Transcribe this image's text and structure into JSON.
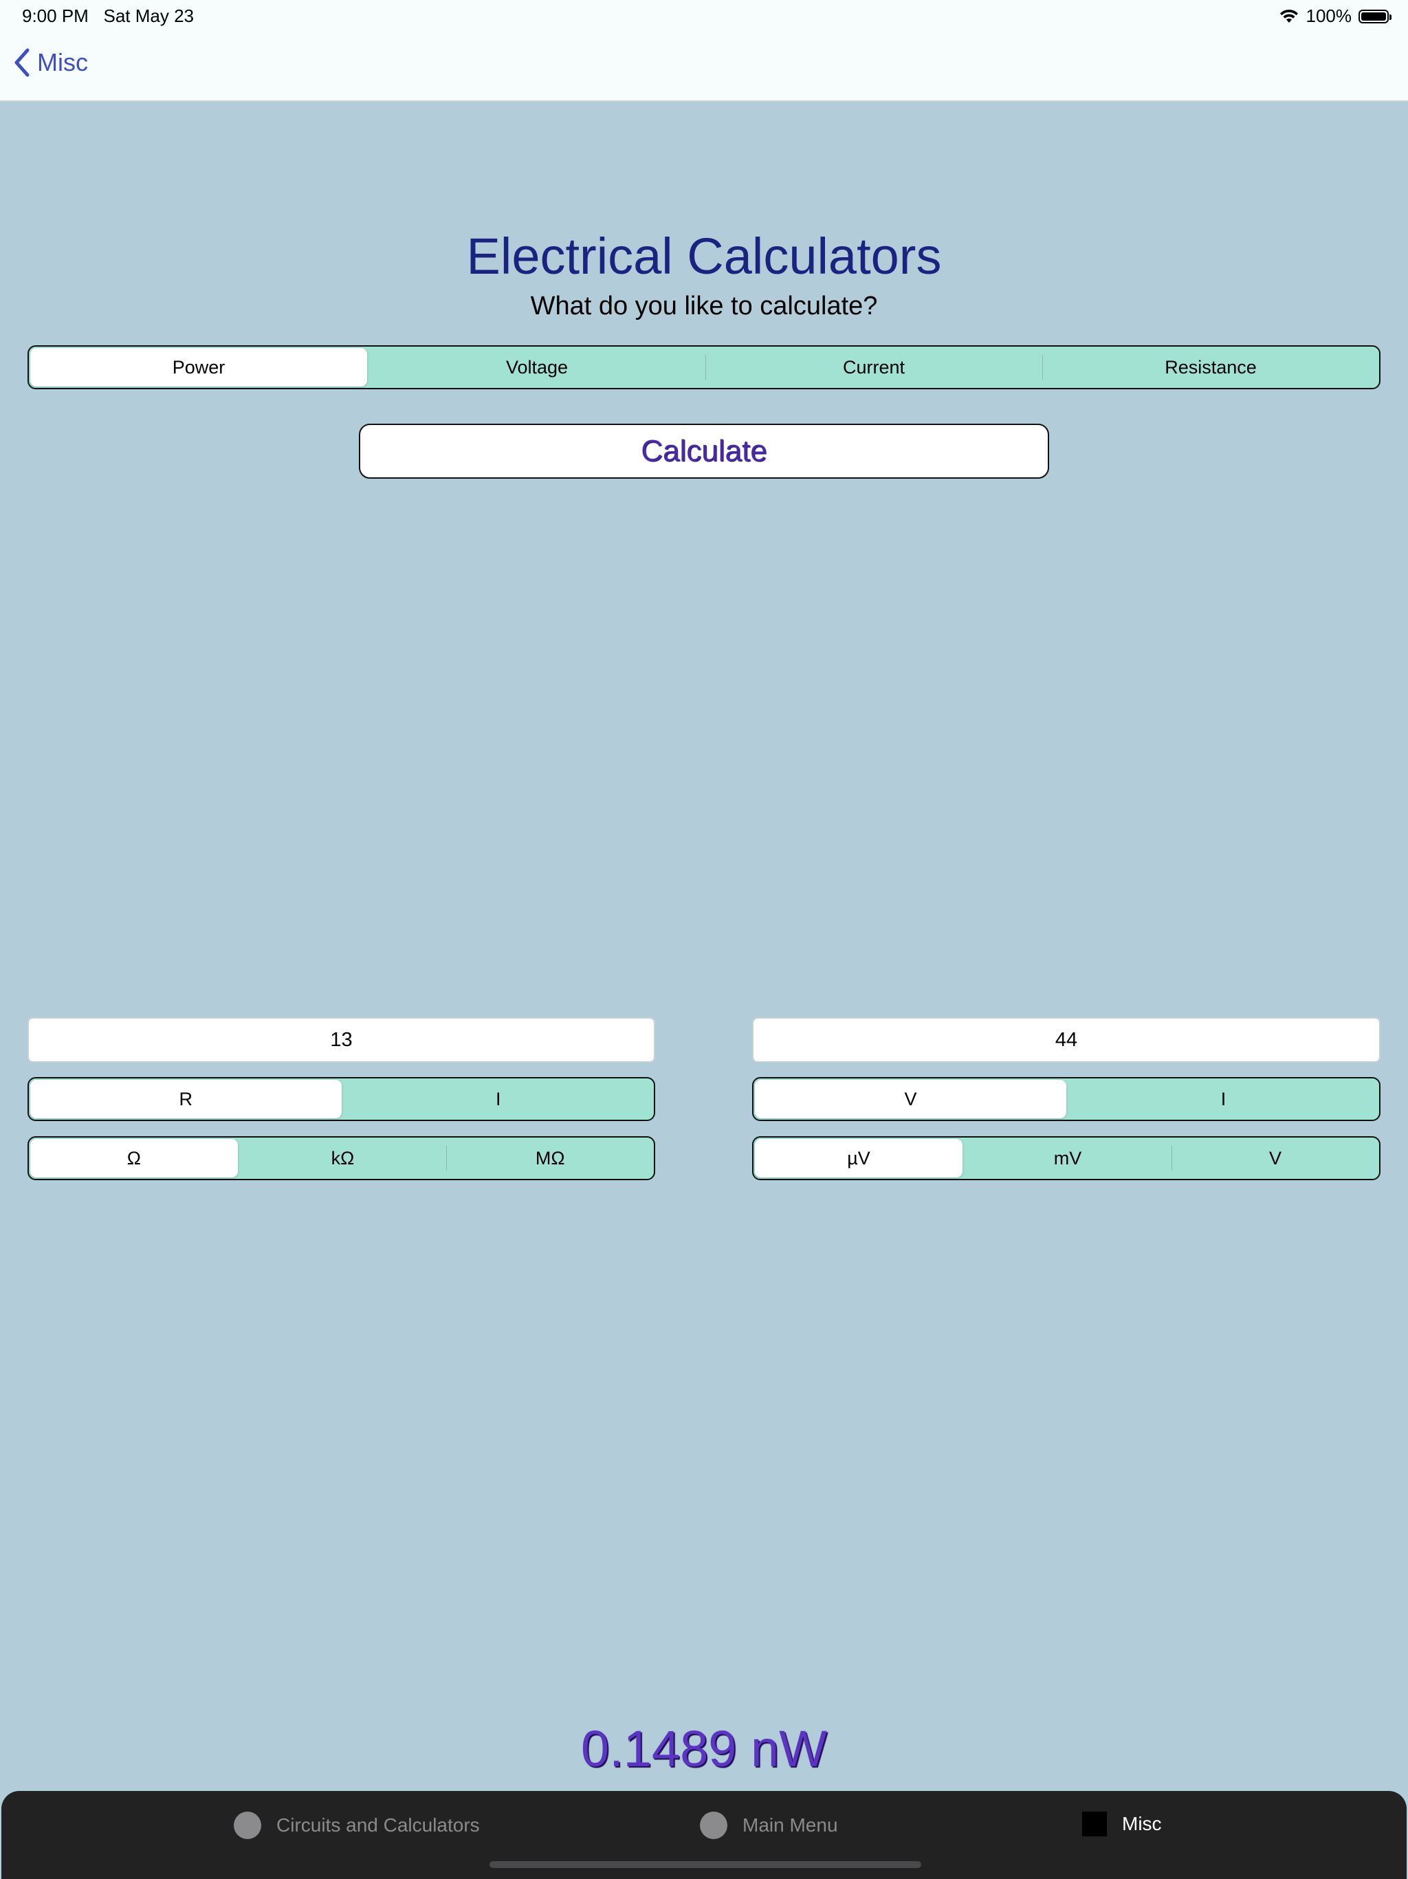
{
  "status": {
    "time": "9:00 PM",
    "date": "Sat May 23",
    "battery": "100%"
  },
  "nav": {
    "back_label": "Misc"
  },
  "header": {
    "title": "Electrical Calculators",
    "subtitle": "What do you like to calculate?"
  },
  "mode_tabs": [
    {
      "label": "Power",
      "selected": true
    },
    {
      "label": "Voltage",
      "selected": false
    },
    {
      "label": "Current",
      "selected": false
    },
    {
      "label": "Resistance",
      "selected": false
    }
  ],
  "calculate_label": "Calculate",
  "left": {
    "value": "13",
    "type_options": [
      {
        "label": "R",
        "selected": true
      },
      {
        "label": "I",
        "selected": false
      }
    ],
    "unit_options": [
      {
        "label": "Ω",
        "selected": true
      },
      {
        "label": "kΩ",
        "selected": false
      },
      {
        "label": "MΩ",
        "selected": false
      }
    ]
  },
  "right": {
    "value": "44",
    "type_options": [
      {
        "label": "V",
        "selected": true
      },
      {
        "label": "I",
        "selected": false
      }
    ],
    "unit_options": [
      {
        "label": "µV",
        "selected": true
      },
      {
        "label": "mV",
        "selected": false
      },
      {
        "label": "V",
        "selected": false
      }
    ]
  },
  "result": "0.1489 nW",
  "tabbar": [
    {
      "label": "Circuits and Calculators",
      "icon": "circle-icon",
      "active": false
    },
    {
      "label": "Main Menu",
      "icon": "circle-icon",
      "active": false
    },
    {
      "label": "Misc",
      "icon": "square-icon",
      "active": true
    }
  ],
  "colors": {
    "background": "#b2cdd9",
    "segment": "#a2e2d2",
    "title": "#1a2480",
    "accent": "#3f4ec0",
    "result": "#5b35c2"
  }
}
